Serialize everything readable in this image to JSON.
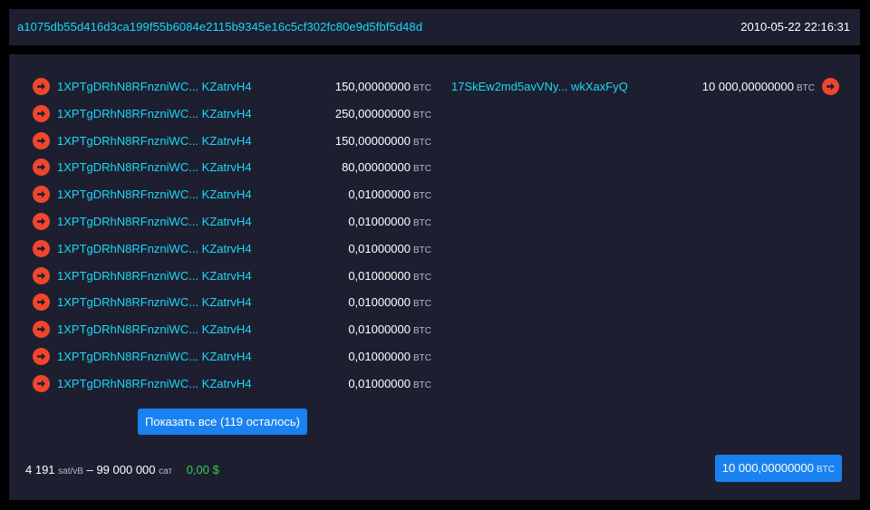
{
  "header": {
    "txid": "a1075db55d416d3ca199f55b6084e2115b9345e16c5cf302fc80e9d5fbf5d48d",
    "timestamp": "2010-05-22 22:16:31"
  },
  "unit": "BTC",
  "vin": [
    {
      "address": "1XPTgDRhN8RFnzniWC... KZatrvH4",
      "amount": "150,00000000"
    },
    {
      "address": "1XPTgDRhN8RFnzniWC... KZatrvH4",
      "amount": "250,00000000"
    },
    {
      "address": "1XPTgDRhN8RFnzniWC... KZatrvH4",
      "amount": "150,00000000"
    },
    {
      "address": "1XPTgDRhN8RFnzniWC... KZatrvH4",
      "amount": "80,00000000"
    },
    {
      "address": "1XPTgDRhN8RFnzniWC... KZatrvH4",
      "amount": "0,01000000"
    },
    {
      "address": "1XPTgDRhN8RFnzniWC... KZatrvH4",
      "amount": "0,01000000"
    },
    {
      "address": "1XPTgDRhN8RFnzniWC... KZatrvH4",
      "amount": "0,01000000"
    },
    {
      "address": "1XPTgDRhN8RFnzniWC... KZatrvH4",
      "amount": "0,01000000"
    },
    {
      "address": "1XPTgDRhN8RFnzniWC... KZatrvH4",
      "amount": "0,01000000"
    },
    {
      "address": "1XPTgDRhN8RFnzniWC... KZatrvH4",
      "amount": "0,01000000"
    },
    {
      "address": "1XPTgDRhN8RFnzniWC... KZatrvH4",
      "amount": "0,01000000"
    },
    {
      "address": "1XPTgDRhN8RFnzniWC... KZatrvH4",
      "amount": "0,01000000"
    }
  ],
  "vout": [
    {
      "address": "17SkEw2md5avVNy... wkXaxFyQ",
      "amount": "10 000,00000000"
    }
  ],
  "show_all_label": "Показать все (119 осталось)",
  "footer": {
    "fee_rate": "4 191",
    "fee_rate_unit": "sat/vB",
    "separator": "–",
    "fee": "99 000 000",
    "fee_unit": "сат",
    "fiat": "0,00 $",
    "total": "10 000,00000000",
    "total_unit": "BTC"
  },
  "icons": {
    "io_arrow": "arrow-right-circle-icon"
  },
  "colors": {
    "background": "#000000",
    "panel": "#1d1f31",
    "link": "#1bd8f4",
    "arrow": "#f1462b",
    "button": "#1a82f0",
    "fiat": "#3bcc49"
  }
}
